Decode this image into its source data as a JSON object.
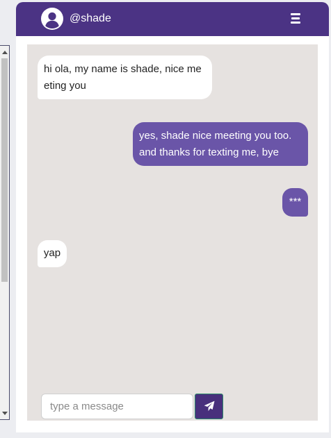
{
  "header": {
    "username": "@shade",
    "avatar_icon": "user-circle-icon",
    "menu_icon": "menu-icon"
  },
  "messages": [
    {
      "direction": "received",
      "text": "hi ola, my name is shade, nice meeting you"
    },
    {
      "direction": "sent",
      "text": "yes, shade nice meeting you too. and thanks for texting me, bye"
    },
    {
      "direction": "sent",
      "text": "***"
    },
    {
      "direction": "received",
      "text": "yap"
    }
  ],
  "composer": {
    "placeholder": "type a message",
    "value": "",
    "send_icon": "paper-plane-icon"
  },
  "colors": {
    "header_bg": "#4b3384",
    "sent_bubble": "#6a55a8",
    "received_bubble": "#ffffff",
    "chat_bg": "#e6e2e0",
    "send_button": "#48307c"
  }
}
